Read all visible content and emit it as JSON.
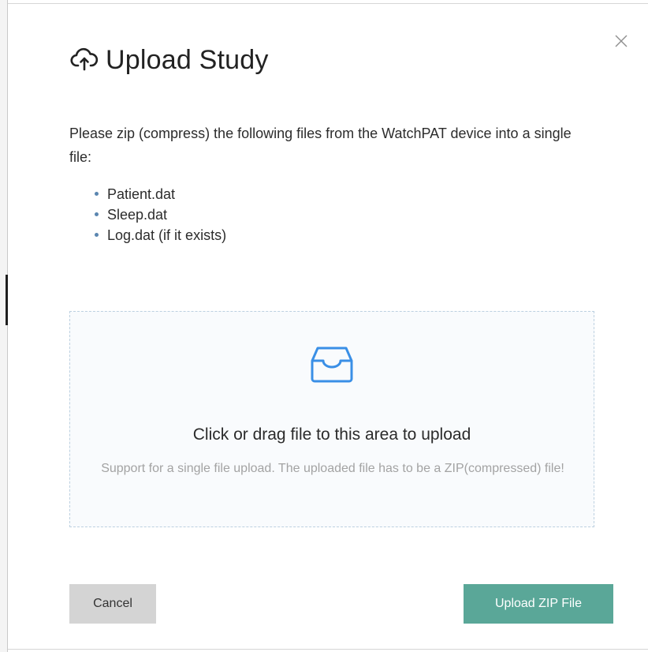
{
  "dialog": {
    "title": "Upload Study",
    "title_icon": "cloud-upload-icon",
    "close_icon": "close-icon",
    "instructions": "Please zip (compress) the following files from the WatchPAT device into a single file:",
    "files": [
      {
        "label": "Patient.dat"
      },
      {
        "label": "Sleep.dat"
      },
      {
        "label": "Log.dat (if it exists)"
      }
    ]
  },
  "dropzone": {
    "icon": "inbox-icon",
    "title": "Click or drag file to this area to upload",
    "hint": "Support for a single file upload. The uploaded file has to be a ZIP(compressed) file!"
  },
  "footer": {
    "cancel_label": "Cancel",
    "upload_label": "Upload ZIP File"
  },
  "colors": {
    "accent": "#5aa798",
    "icon_blue": "#3a8fe6",
    "bullet": "#5a86b0"
  }
}
